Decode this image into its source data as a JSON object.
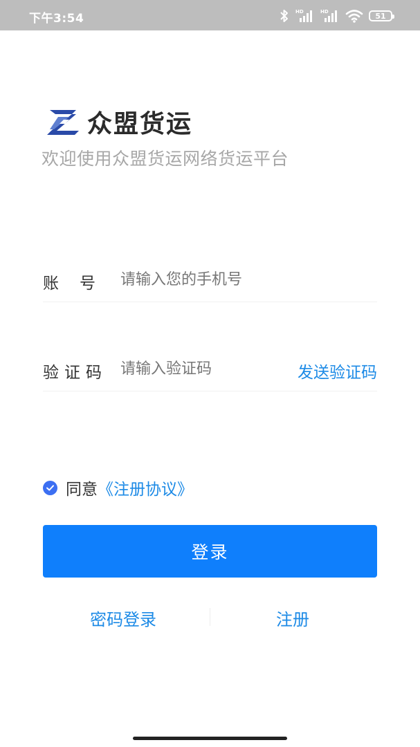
{
  "status_bar": {
    "time": "下午3:54",
    "icons": [
      "bluetooth-icon",
      "signal-hd-icon",
      "signal-hd-icon",
      "wifi-icon"
    ],
    "hd_label": "HD",
    "battery": "51"
  },
  "brand": {
    "logo_icon": "zl-logo",
    "name": "众盟货运",
    "welcome": "欢迎使用众盟货运网络货运平台",
    "logo_color": "#2a4aa8"
  },
  "form": {
    "account_label": "账号",
    "account_placeholder": "请输入您的手机号",
    "code_label": "验证码",
    "code_placeholder": "请输入验证码",
    "send_code": "发送验证码"
  },
  "agreement": {
    "checked": true,
    "prefix": "同意",
    "link": "《注册协议》"
  },
  "login_button": "登录",
  "links": {
    "password_login": "密码登录",
    "register": "注册"
  },
  "colors": {
    "primary": "#0f7ffc",
    "link": "#1c8ae6",
    "check": "#3c6ff2"
  }
}
